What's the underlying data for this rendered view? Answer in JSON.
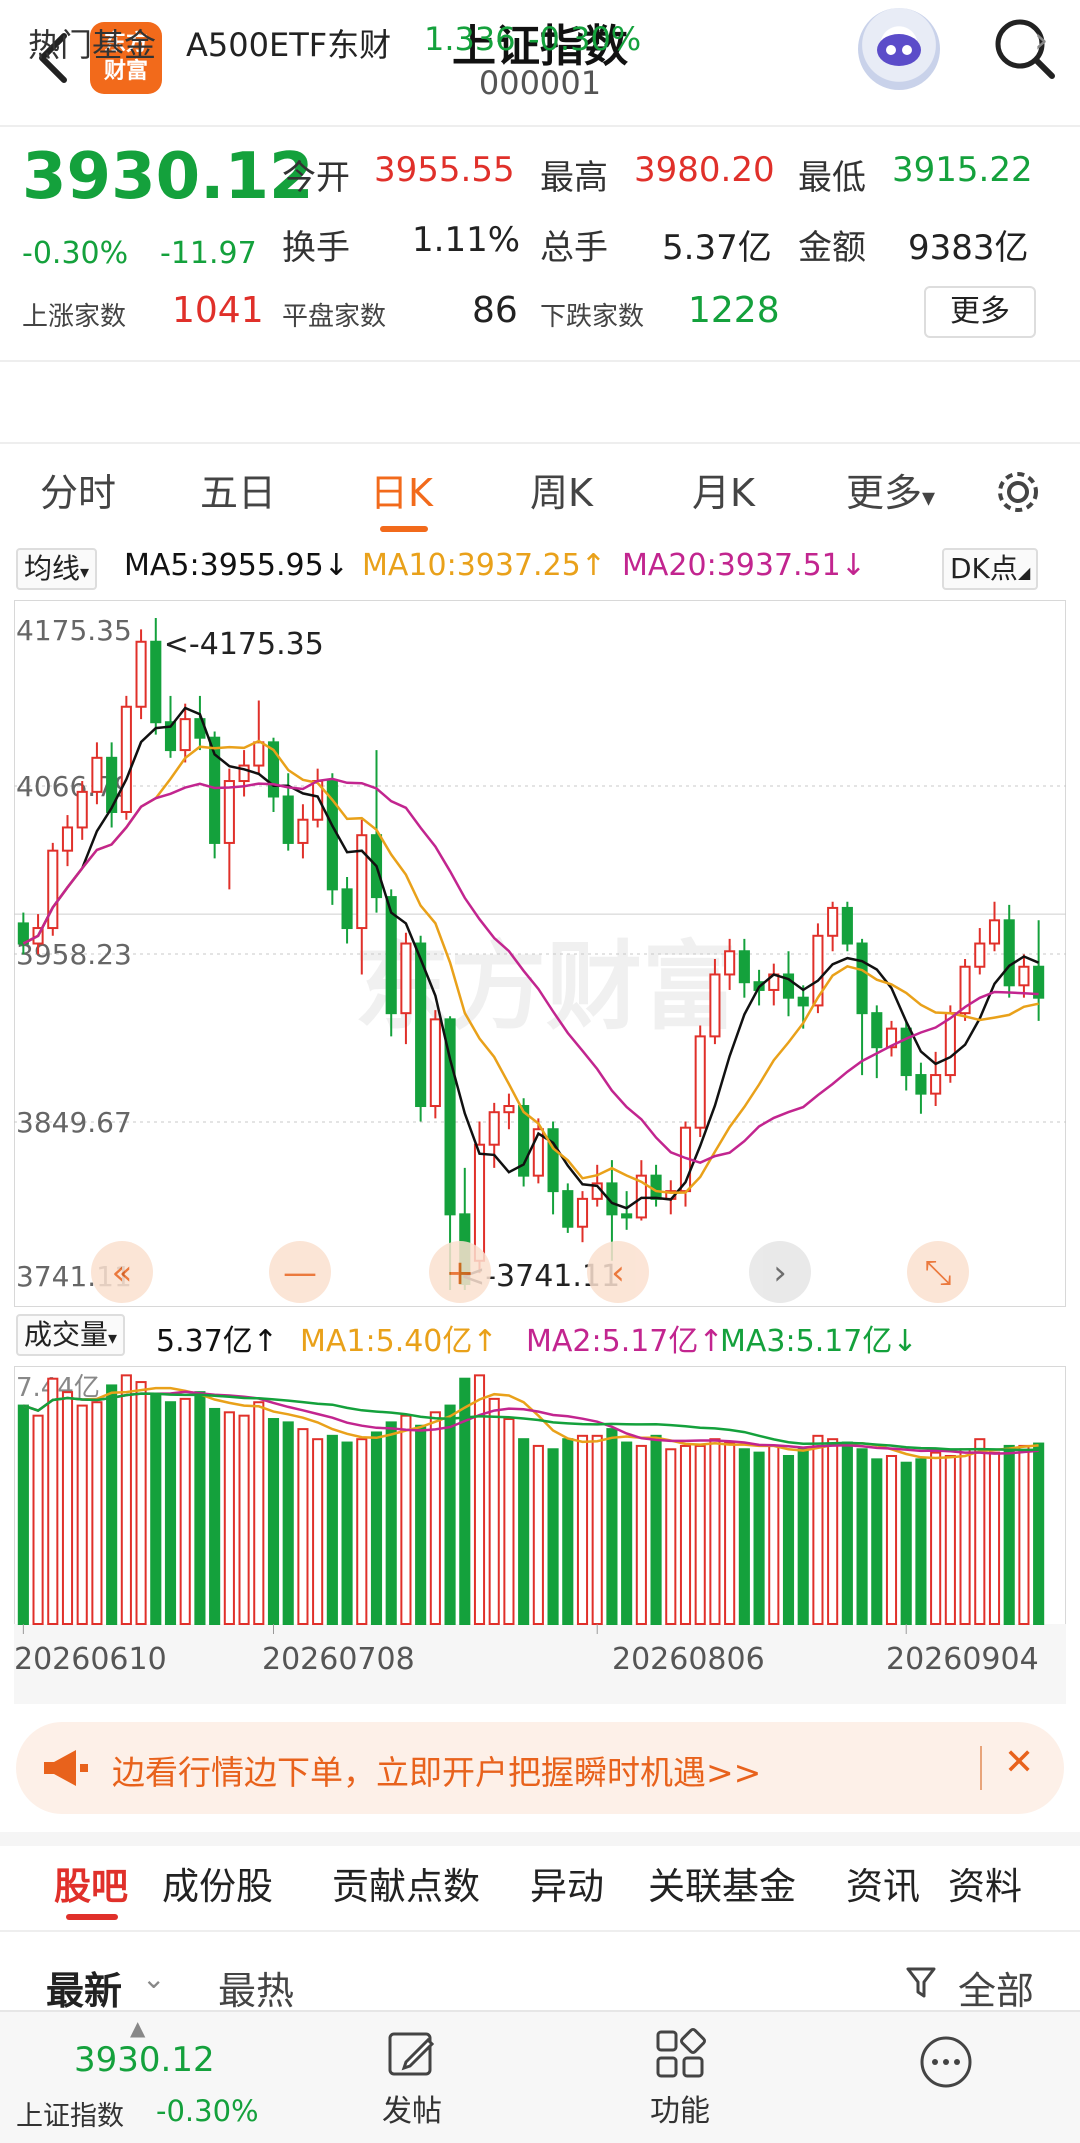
{
  "header": {
    "title": "上证指数",
    "code": "000001",
    "logo_line1": "东方",
    "logo_line2": "财富"
  },
  "quote": {
    "price": "3930.12",
    "change_pct": "-0.30%",
    "change_val": "-11.97",
    "open_label": "今开",
    "open": "3955.55",
    "high_label": "最高",
    "high": "3980.20",
    "low_label": "最低",
    "low": "3915.22",
    "turnover_label": "换手",
    "turnover": "1.11%",
    "volume_label": "总手",
    "volume": "5.37亿",
    "amount_label": "金额",
    "amount": "9383亿",
    "up_label": "上涨家数",
    "up": "1041",
    "flat_label": "平盘家数",
    "flat": "86",
    "down_label": "下跌家数",
    "down": "1228",
    "more_label": "更多"
  },
  "hot_fund": {
    "label": "热门基金",
    "name": "A500ETF东财",
    "price": "1.336",
    "change": "-0.30%"
  },
  "tabs": [
    "分时",
    "五日",
    "日K",
    "周K",
    "月K",
    "更多"
  ],
  "ma_legend": {
    "chip": "均线",
    "ma5": "MA5:3955.95↓",
    "ma10": "MA10:3937.25↑",
    "ma20": "MA20:3937.51↓",
    "dk": "DK点"
  },
  "vol_legend": {
    "chip": "成交量",
    "vol": "5.37亿↑",
    "ma1": "MA1:5.40亿↑",
    "ma2": "MA2:5.17亿↑",
    "ma3": "MA3:5.17亿↓"
  },
  "colors": {
    "up": "#e0302a",
    "down": "#14a13c",
    "ma5": "#111111",
    "ma10": "#e9a11a",
    "ma20": "#c2258f",
    "accent": "#f26a1b"
  },
  "chart_data": {
    "type": "candlestick",
    "y_ticks": [
      "4175.35",
      "4066.79",
      "3958.23",
      "3849.67",
      "3741.11"
    ],
    "ylim": [
      3741.11,
      4175.35
    ],
    "max_label": "<-4175.35",
    "min_label": "<-3741.11",
    "x_ticks": [
      "20260610",
      "20260708",
      "20260806",
      "20260904"
    ],
    "candles": [
      [
        3978,
        3965,
        3985,
        3958
      ],
      [
        3965,
        3975,
        3984,
        3958
      ],
      [
        3975,
        4025,
        4030,
        3970
      ],
      [
        4025,
        4040,
        4048,
        4015
      ],
      [
        4040,
        4063,
        4070,
        4032
      ],
      [
        4063,
        4085,
        4095,
        4055
      ],
      [
        4085,
        4050,
        4095,
        4040
      ],
      [
        4050,
        4118,
        4125,
        4045
      ],
      [
        4118,
        4160,
        4168,
        4110
      ],
      [
        4160,
        4108,
        4175.35,
        4100
      ],
      [
        4108,
        4090,
        4125,
        4085
      ],
      [
        4090,
        4110,
        4120,
        4082
      ],
      [
        4110,
        4098,
        4125,
        4090
      ],
      [
        4098,
        4030,
        4102,
        4020
      ],
      [
        4030,
        4070,
        4078,
        4000
      ],
      [
        4070,
        4080,
        4090,
        4060
      ],
      [
        4080,
        4095,
        4122,
        4075
      ],
      [
        4095,
        4060,
        4098,
        4050
      ],
      [
        4060,
        4030,
        4075,
        4025
      ],
      [
        4030,
        4045,
        4055,
        4020
      ],
      [
        4045,
        4070,
        4078,
        4040
      ],
      [
        4070,
        4000,
        4075,
        3990
      ],
      [
        4000,
        3975,
        4008,
        3965
      ],
      [
        3975,
        4035,
        4045,
        3945
      ],
      [
        4035,
        3995,
        4090,
        3985
      ],
      [
        3995,
        3920,
        4000,
        3905
      ],
      [
        3920,
        3965,
        3972,
        3900
      ],
      [
        3965,
        3860,
        3970,
        3850
      ],
      [
        3860,
        3916,
        3922,
        3852
      ],
      [
        3916,
        3790,
        3918,
        3741.11
      ],
      [
        3790,
        3745,
        3820,
        3741.11
      ],
      [
        3760,
        3835,
        3850,
        3752
      ],
      [
        3835,
        3856,
        3862,
        3820
      ],
      [
        3856,
        3860,
        3868,
        3845
      ],
      [
        3860,
        3815,
        3865,
        3808
      ],
      [
        3815,
        3845,
        3852,
        3810
      ],
      [
        3845,
        3805,
        3850,
        3790
      ],
      [
        3805,
        3782,
        3810,
        3778
      ],
      [
        3782,
        3800,
        3805,
        3772
      ],
      [
        3800,
        3810,
        3822,
        3795
      ],
      [
        3810,
        3790,
        3825,
        3760
      ],
      [
        3790,
        3788,
        3805,
        3780
      ],
      [
        3788,
        3815,
        3825,
        3786
      ],
      [
        3815,
        3800,
        3822,
        3795
      ],
      [
        3800,
        3805,
        3812,
        3790
      ],
      [
        3805,
        3846,
        3850,
        3795
      ],
      [
        3846,
        3905,
        3912,
        3840
      ],
      [
        3905,
        3945,
        3955,
        3900
      ],
      [
        3945,
        3960,
        3968,
        3935
      ],
      [
        3960,
        3940,
        3968,
        3930
      ],
      [
        3940,
        3935,
        3948,
        3925
      ],
      [
        3935,
        3945,
        3952,
        3925
      ],
      [
        3945,
        3930,
        3960,
        3918
      ],
      [
        3930,
        3925,
        3938,
        3910
      ],
      [
        3925,
        3970,
        3978,
        3920
      ],
      [
        3970,
        3988,
        3992,
        3960
      ],
      [
        3988,
        3965,
        3992,
        3960
      ],
      [
        3965,
        3920,
        3968,
        3880
      ],
      [
        3920,
        3898,
        3925,
        3878
      ],
      [
        3898,
        3910,
        3915,
        3892
      ],
      [
        3910,
        3880,
        3915,
        3870
      ],
      [
        3880,
        3868,
        3888,
        3855
      ],
      [
        3868,
        3880,
        3895,
        3860
      ],
      [
        3880,
        3920,
        3925,
        3875
      ],
      [
        3920,
        3950,
        3955,
        3915
      ],
      [
        3950,
        3965,
        3975,
        3945
      ],
      [
        3965,
        3980,
        3992,
        3960
      ],
      [
        3980,
        3938,
        3990,
        3930
      ],
      [
        3938,
        3950,
        3958,
        3930
      ],
      [
        3950,
        3930,
        3980,
        3915
      ]
    ],
    "volumes": [
      6.5,
      6.2,
      7.3,
      6.9,
      6.5,
      6.6,
      7.1,
      7.4,
      7.2,
      6.8,
      6.6,
      6.7,
      6.9,
      6.4,
      6.3,
      6.2,
      6.6,
      6.1,
      6.0,
      5.8,
      5.5,
      5.6,
      5.4,
      5.5,
      5.7,
      6.0,
      6.2,
      5.9,
      6.3,
      6.5,
      7.3,
      7.4,
      6.7,
      6.1,
      5.5,
      5.3,
      5.2,
      5.5,
      5.6,
      5.6,
      5.8,
      5.4,
      5.3,
      5.6,
      5.2,
      5.3,
      5.3,
      5.5,
      5.4,
      5.2,
      5.1,
      5.3,
      5.0,
      5.2,
      5.6,
      5.5,
      5.4,
      5.2,
      4.9,
      5.0,
      4.8,
      4.9,
      5.1,
      5.0,
      5.2,
      5.5,
      5.1,
      5.3,
      5.3,
      5.37
    ],
    "vol_ylim": [
      0,
      7.44
    ],
    "vol_max_label": "7.44亿"
  },
  "promo": {
    "text": "边看行情边下单，立即开户把握瞬时机遇>>",
    "close": "✕"
  },
  "section_tabs": [
    "股吧",
    "成份股",
    "贡献点数",
    "异动",
    "关联基金",
    "资讯",
    "资料"
  ],
  "filter": {
    "latest": "最新",
    "hot": "最热",
    "all": "全部"
  },
  "bottom_bar": {
    "price": "3930.12",
    "name": "上证指数",
    "pct": "-0.30%",
    "post": "发帖",
    "function": "功能"
  }
}
